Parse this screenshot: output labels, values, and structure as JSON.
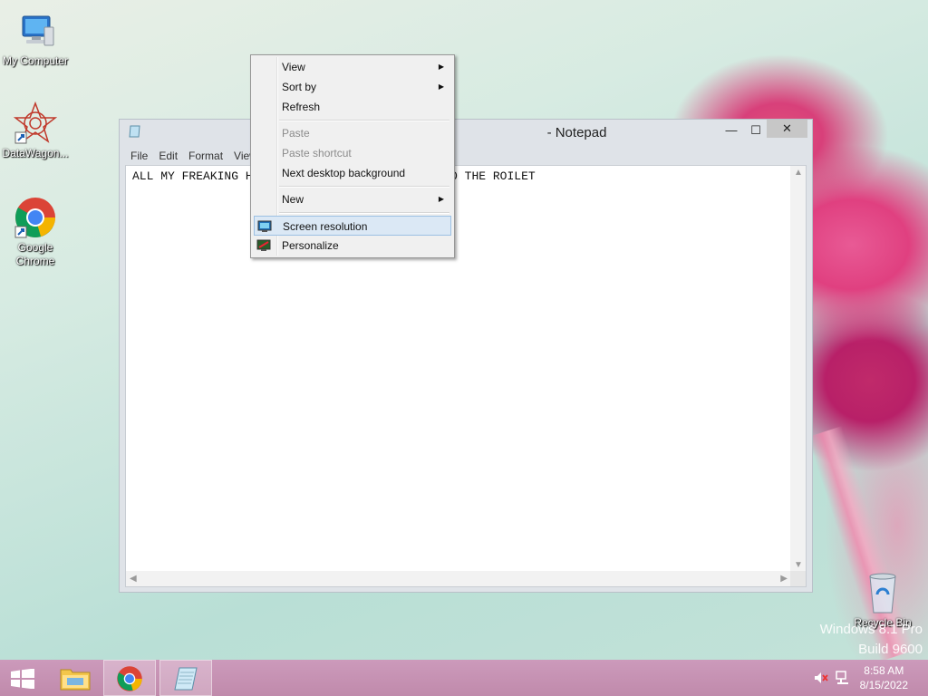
{
  "desktop": {
    "icons": [
      {
        "label": "My Computer"
      },
      {
        "label": "DataWagon..."
      },
      {
        "label": "Google Chrome"
      },
      {
        "label": "Recycle Bin"
      }
    ],
    "watermark": {
      "line1": "Windows 8.1 Pro",
      "line2": "Build 9600"
    }
  },
  "notepad": {
    "title": "- Notepad",
    "menu": [
      "File",
      "Edit",
      "Format",
      "View"
    ],
    "content": "ALL MY FREAKING H                          NTO THE ROILET",
    "controls": {
      "minimize": "—",
      "maximize": "☐",
      "close": "✕"
    }
  },
  "context_menu": {
    "items": [
      {
        "label": "View",
        "submenu": true,
        "disabled": false
      },
      {
        "label": "Sort by",
        "submenu": true,
        "disabled": false
      },
      {
        "label": "Refresh",
        "submenu": false,
        "disabled": false
      },
      {
        "label": "Paste",
        "submenu": false,
        "disabled": true
      },
      {
        "label": "Paste shortcut",
        "submenu": false,
        "disabled": true
      },
      {
        "label": "Next desktop background",
        "submenu": false,
        "disabled": false
      },
      {
        "label": "New",
        "submenu": true,
        "disabled": false
      },
      {
        "label": "Screen resolution",
        "submenu": false,
        "disabled": false,
        "highlighted": true
      },
      {
        "label": "Personalize",
        "submenu": false,
        "disabled": false
      }
    ],
    "submenu_glyph": "▶"
  },
  "taskbar": {
    "clock": {
      "time": "8:58 AM",
      "date": "8/15/2022"
    }
  },
  "colors": {
    "taskbar": "#c08aab",
    "menu_highlight": "#dbe8f5",
    "menu_highlight_border": "#9cc0e3"
  }
}
